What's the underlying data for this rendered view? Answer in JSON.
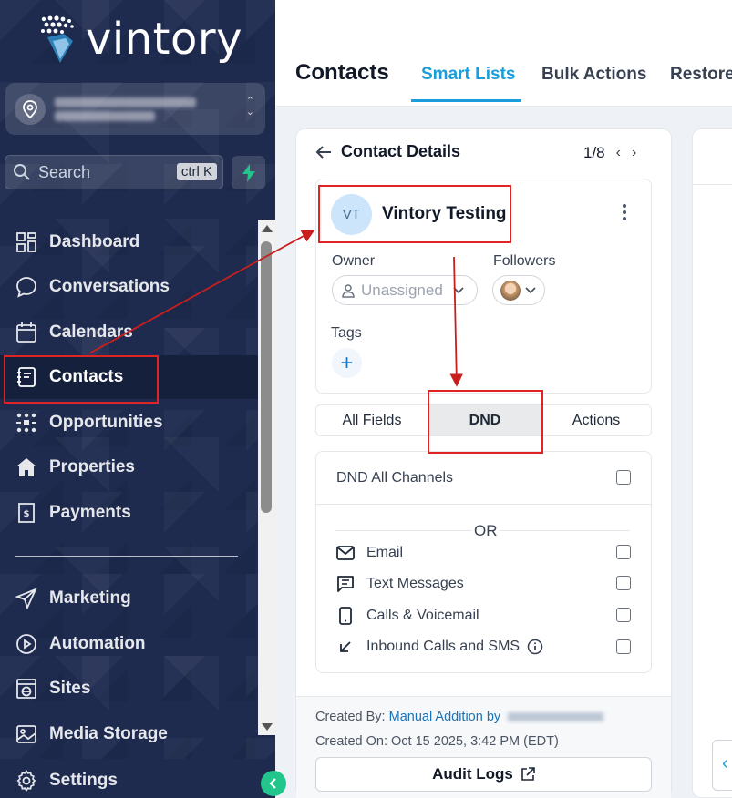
{
  "brand": {
    "name": "vintory"
  },
  "sidebar": {
    "search_label": "Search",
    "shortcut": "ctrl K",
    "items": [
      {
        "label": "Dashboard",
        "icon": "dashboard-icon"
      },
      {
        "label": "Conversations",
        "icon": "chat-bubble-icon"
      },
      {
        "label": "Calendars",
        "icon": "calendar-icon"
      },
      {
        "label": "Contacts",
        "icon": "contact-book-icon",
        "active": true
      },
      {
        "label": "Opportunities",
        "icon": "opportunities-icon"
      },
      {
        "label": "Properties",
        "icon": "house-icon"
      },
      {
        "label": "Payments",
        "icon": "receipt-icon"
      },
      {
        "label": "Marketing",
        "icon": "send-icon"
      },
      {
        "label": "Automation",
        "icon": "play-circle-icon"
      },
      {
        "label": "Sites",
        "icon": "globe-window-icon"
      },
      {
        "label": "Media Storage",
        "icon": "image-icon"
      },
      {
        "label": "Settings",
        "icon": "gear-icon"
      }
    ]
  },
  "header": {
    "title": "Contacts",
    "tabs": [
      {
        "label": "Smart Lists",
        "active": true
      },
      {
        "label": "Bulk Actions"
      },
      {
        "label": "Restore"
      }
    ]
  },
  "contact_details": {
    "heading": "Contact Details",
    "pager": "1/8",
    "avatar_initials": "VT",
    "name": "Vintory Testing",
    "owner_label": "Owner",
    "owner_value": "Unassigned",
    "followers_label": "Followers",
    "tags_label": "Tags",
    "tabs": [
      {
        "label": "All Fields"
      },
      {
        "label": "DND",
        "active": true
      },
      {
        "label": "Actions"
      }
    ],
    "dnd": {
      "all_channels": "DND All Channels",
      "or": "OR",
      "channels": [
        {
          "label": "Email",
          "icon": "mail-icon",
          "checked": false
        },
        {
          "label": "Text Messages",
          "icon": "message-icon",
          "checked": false
        },
        {
          "label": "Calls & Voicemail",
          "icon": "phone-icon",
          "checked": false
        },
        {
          "label": "Inbound Calls and SMS",
          "icon": "arrow-down-left-icon",
          "checked": false
        }
      ]
    },
    "footer": {
      "created_by_label": "Created By:",
      "created_by_value": "Manual Addition by",
      "created_on_label": "Created On:",
      "created_on_value": "Oct 15 2025, 3:42 PM (EDT)",
      "audit_button": "Audit Logs"
    }
  },
  "colors": {
    "accent": "#1a9edb",
    "sidebar_bg": "#1e2b4f",
    "annotation": "#e02424",
    "fab": "#22c58b"
  }
}
